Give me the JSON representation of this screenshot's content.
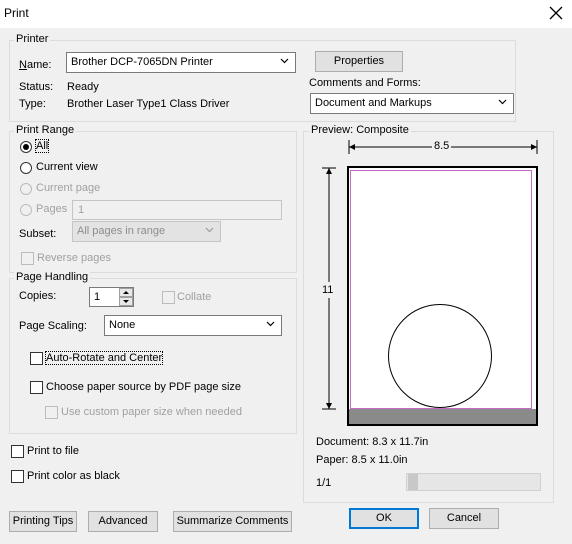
{
  "window": {
    "title": "Print"
  },
  "printer": {
    "legend": "Printer",
    "name_label": "Name:",
    "name_value": "Brother DCP-7065DN Printer",
    "status_label": "Status:",
    "status_value": "Ready",
    "type_label": "Type:",
    "type_value": "Brother Laser Type1 Class Driver",
    "properties_label": "Properties",
    "comments_label": "Comments and Forms:",
    "comments_value": "Document and Markups"
  },
  "print_range": {
    "legend": "Print Range",
    "all": "All",
    "current_view": "Current view",
    "current_page": "Current page",
    "pages": "Pages",
    "pages_value": "1",
    "subset_label": "Subset:",
    "subset_value": "All pages in range",
    "reverse_pages": "Reverse pages",
    "selected": "All"
  },
  "page_handling": {
    "legend": "Page Handling",
    "copies_label": "Copies:",
    "copies_value": "1",
    "collate": "Collate",
    "scaling_label": "Page Scaling:",
    "scaling_value": "None",
    "auto_rotate": "Auto-Rotate and Center",
    "paper_source": "Choose paper source by PDF page size",
    "custom_paper": "Use custom paper size when needed"
  },
  "options": {
    "print_to_file": "Print to file",
    "print_color_black": "Print color as black"
  },
  "preview": {
    "legend": "Preview: Composite",
    "width_label": "8.5",
    "height_label": "11",
    "document_size": "Document: 8.3 x 11.7in",
    "paper_size": "Paper: 8.5 x 11.0in",
    "page_indicator": "1/1"
  },
  "buttons": {
    "printing_tips": "Printing Tips",
    "advanced": "Advanced",
    "summarize": "Summarize Comments",
    "ok": "OK",
    "cancel": "Cancel"
  },
  "icons": {
    "close": "close-icon",
    "dropdown": "chevron-down-icon",
    "spin_up": "spin-up-icon",
    "spin_down": "spin-down-icon"
  }
}
